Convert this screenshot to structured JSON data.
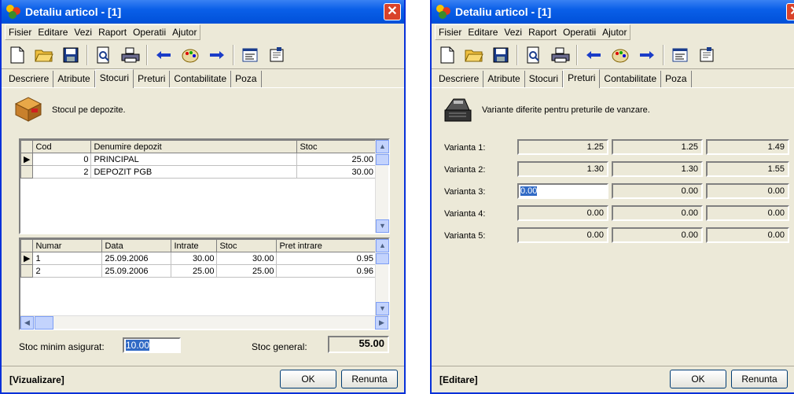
{
  "window_title": "Detaliu articol - [1]",
  "menu": [
    "Fisier",
    "Editare",
    "Vezi",
    "Raport",
    "Operatii",
    "Ajutor"
  ],
  "left": {
    "tabs": [
      "Descriere",
      "Atribute",
      "Stocuri",
      "Preturi",
      "Contabilitate",
      "Poza"
    ],
    "active_tab": "Stocuri",
    "header_text": "Stocul pe depozite.",
    "depozit_grid": {
      "headers": [
        "Cod",
        "Denumire depozit",
        "Stoc"
      ],
      "rows": [
        [
          "0",
          "PRINCIPAL",
          "25.00"
        ],
        [
          "2",
          "DEPOZIT PGB",
          "30.00"
        ]
      ]
    },
    "miscari_grid": {
      "headers": [
        "Numar",
        "Data",
        "Intrate",
        "Stoc",
        "Pret intrare"
      ],
      "rows": [
        [
          "1",
          "25.09.2006",
          "30.00",
          "30.00",
          "0.95"
        ],
        [
          "2",
          "25.09.2006",
          "25.00",
          "25.00",
          "0.96"
        ]
      ]
    },
    "stoc_minim_label": "Stoc minim asigurat:",
    "stoc_minim_value": "10.00",
    "stoc_general_label": "Stoc general:",
    "stoc_general_value": "55.00",
    "status": "[Vizualizare]",
    "ok_label": "OK",
    "cancel_label": "Renunta"
  },
  "right": {
    "tabs": [
      "Descriere",
      "Atribute",
      "Stocuri",
      "Preturi",
      "Contabilitate",
      "Poza"
    ],
    "active_tab": "Preturi",
    "header_text": "Variante diferite pentru preturile de vanzare.",
    "variants": [
      {
        "label": "Varianta 1:",
        "values": [
          "1.25",
          "1.25",
          "1.49"
        ]
      },
      {
        "label": "Varianta 2:",
        "values": [
          "1.30",
          "1.30",
          "1.55"
        ]
      },
      {
        "label": "Varianta 3:",
        "values": [
          "0.00",
          "0.00",
          "0.00"
        ]
      },
      {
        "label": "Varianta 4:",
        "values": [
          "0.00",
          "0.00",
          "0.00"
        ]
      },
      {
        "label": "Varianta 5:",
        "values": [
          "0.00",
          "0.00",
          "0.00"
        ]
      }
    ],
    "status": "[Editare]",
    "ok_label": "OK",
    "cancel_label": "Renunta"
  }
}
